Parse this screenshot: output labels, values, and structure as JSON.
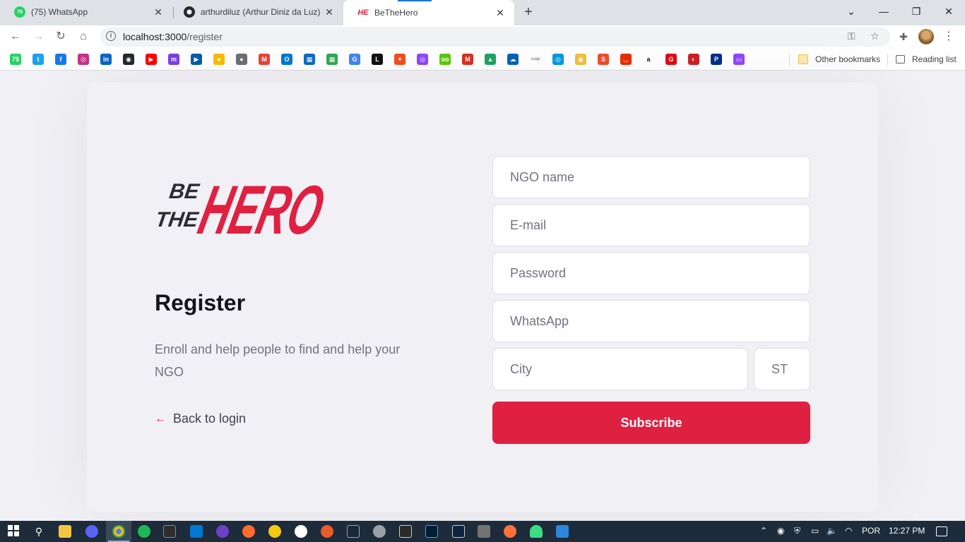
{
  "browser": {
    "tabs": [
      {
        "title": "(75) WhatsApp",
        "badge": "75",
        "icon": "whatsapp-icon",
        "color": "#25d366"
      },
      {
        "title": "arthurdiluz (Arthur Diniz da Luz)",
        "icon": "github-icon",
        "color": "#24292e"
      },
      {
        "title": "BeTheHero",
        "icon": "bethehero-icon",
        "color": "#e02041",
        "favicon_text": "HE",
        "active": true
      }
    ],
    "close_glyph": "✕",
    "new_tab_glyph": "+",
    "address": {
      "host": "localhost:3000",
      "path": "/register"
    },
    "bookmarks": [
      {
        "name": "whatsapp",
        "color": "#25d366",
        "glyph": "75"
      },
      {
        "name": "twitter",
        "color": "#1da1f2",
        "glyph": "t"
      },
      {
        "name": "facebook",
        "color": "#1877f2",
        "glyph": "f"
      },
      {
        "name": "instagram",
        "color": "#c13584",
        "glyph": "◎"
      },
      {
        "name": "linkedin",
        "color": "#0a66c2",
        "glyph": "in"
      },
      {
        "name": "github",
        "color": "#24292e",
        "glyph": "◉"
      },
      {
        "name": "youtube",
        "color": "#ff0000",
        "glyph": "▶"
      },
      {
        "name": "mastodon",
        "color": "#7b3fe4",
        "glyph": "m"
      },
      {
        "name": "play",
        "color": "#0b5cad",
        "glyph": "▶"
      },
      {
        "name": "keep",
        "color": "#fbbc04",
        "glyph": "●"
      },
      {
        "name": "apple",
        "color": "#6e6e73",
        "glyph": "●"
      },
      {
        "name": "gmail",
        "color": "#ea4335",
        "glyph": "M"
      },
      {
        "name": "outlook",
        "color": "#0078d4",
        "glyph": "O"
      },
      {
        "name": "calendar",
        "color": "#0f6cbd",
        "glyph": "▦"
      },
      {
        "name": "classroom",
        "color": "#34a853",
        "glyph": "▦"
      },
      {
        "name": "translate",
        "color": "#4285f4",
        "glyph": "G"
      },
      {
        "name": "notion",
        "color": "#111111",
        "glyph": "L"
      },
      {
        "name": "figma",
        "color": "#f24e1e",
        "glyph": "✦"
      },
      {
        "name": "twitch-alt",
        "color": "#9146ff",
        "glyph": "◎"
      },
      {
        "name": "duolingo",
        "color": "#58cc02",
        "glyph": "oo"
      },
      {
        "name": "meet",
        "color": "#d93025",
        "glyph": "M"
      },
      {
        "name": "drive",
        "color": "#1fa463",
        "glyph": "▲"
      },
      {
        "name": "onedrive",
        "color": "#0364b8",
        "glyph": "☁"
      },
      {
        "name": "suap",
        "color": "#ffffff",
        "glyph": "suap",
        "text_color": "#666666"
      },
      {
        "name": "tool",
        "color": "#009bde",
        "glyph": "◎"
      },
      {
        "name": "emoji",
        "color": "#f0c040",
        "glyph": "◉"
      },
      {
        "name": "shopee",
        "color": "#ee4d2d",
        "glyph": "S"
      },
      {
        "name": "aliexpress",
        "color": "#e62e04",
        "glyph": "◡"
      },
      {
        "name": "amazon",
        "color": "#ffffff",
        "glyph": "a",
        "text_color": "#111111"
      },
      {
        "name": "gmaps",
        "color": "#e50914",
        "glyph": "G"
      },
      {
        "name": "rocketseat",
        "color": "#cc2229",
        "glyph": "◐"
      },
      {
        "name": "paypal",
        "color": "#003087",
        "glyph": "P"
      },
      {
        "name": "twitch",
        "color": "#9146ff",
        "glyph": "▭"
      }
    ],
    "other_bookmarks": "Other bookmarks",
    "reading_list": "Reading list"
  },
  "page": {
    "logo": {
      "be": "BE",
      "the": "THE",
      "hero": "HERO",
      "color": "#e02041",
      "dark": "#2b2b33"
    },
    "title": "Register",
    "description": "Enroll and help people to find and help your NGO",
    "back_link": {
      "arrow": "←",
      "label": "Back to login"
    },
    "form": {
      "ngo_name_placeholder": "NGO name",
      "email_placeholder": "E-mail",
      "password_placeholder": "Password",
      "whatsapp_placeholder": "WhatsApp",
      "city_placeholder": "City",
      "state_placeholder": "ST",
      "submit_label": "Subscribe"
    },
    "accent_color": "#e02041"
  },
  "taskbar": {
    "language": "POR",
    "time": "12:27 PM"
  }
}
